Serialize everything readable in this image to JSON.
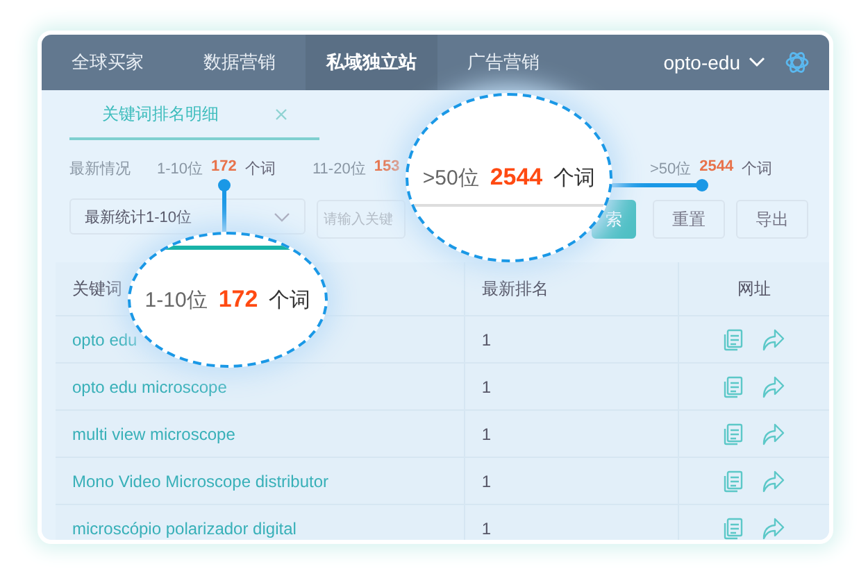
{
  "nav": {
    "tabs": [
      {
        "label": "全球买家",
        "selected": false
      },
      {
        "label": "数据营销",
        "selected": false
      },
      {
        "label": "私域独立站",
        "selected": true
      },
      {
        "label": "广告营销",
        "selected": false
      }
    ],
    "account": "opto-edu"
  },
  "page_tabs": [
    {
      "label": "关键词排名明细",
      "selected": true,
      "closable": true
    }
  ],
  "stats": {
    "label": "最新情况",
    "items": [
      {
        "range": "1-10位",
        "count": "172",
        "unit": "个词"
      },
      {
        "range": "11-20位",
        "count": "153"
      },
      {
        "range": ">50位",
        "count": "2544",
        "unit": "个词"
      }
    ]
  },
  "filters": {
    "select": "最新统计1-10位",
    "search": {
      "placeholder": "请输入关键"
    },
    "buttons": [
      {
        "label": "索",
        "kind": "primary"
      },
      {
        "label": "重置",
        "kind": "plain"
      },
      {
        "label": "导出",
        "kind": "plain"
      }
    ]
  },
  "table": {
    "columns": [
      "关键词",
      "最新排名",
      "网址"
    ],
    "rows": [
      {
        "keyword": "opto edu",
        "rank": "1"
      },
      {
        "keyword": "opto edu microscope",
        "rank": "1"
      },
      {
        "keyword": "multi view microscope",
        "rank": "1"
      },
      {
        "keyword": "Mono Video Microscope distributor",
        "rank": "1"
      },
      {
        "keyword": "microscópio polarizador digital",
        "rank": "1"
      }
    ]
  },
  "callouts": [
    {
      "range": "1-10位",
      "count": "172",
      "unit": "个词"
    },
    {
      "range": ">50位",
      "count": "2544",
      "unit": "个词"
    }
  ]
}
